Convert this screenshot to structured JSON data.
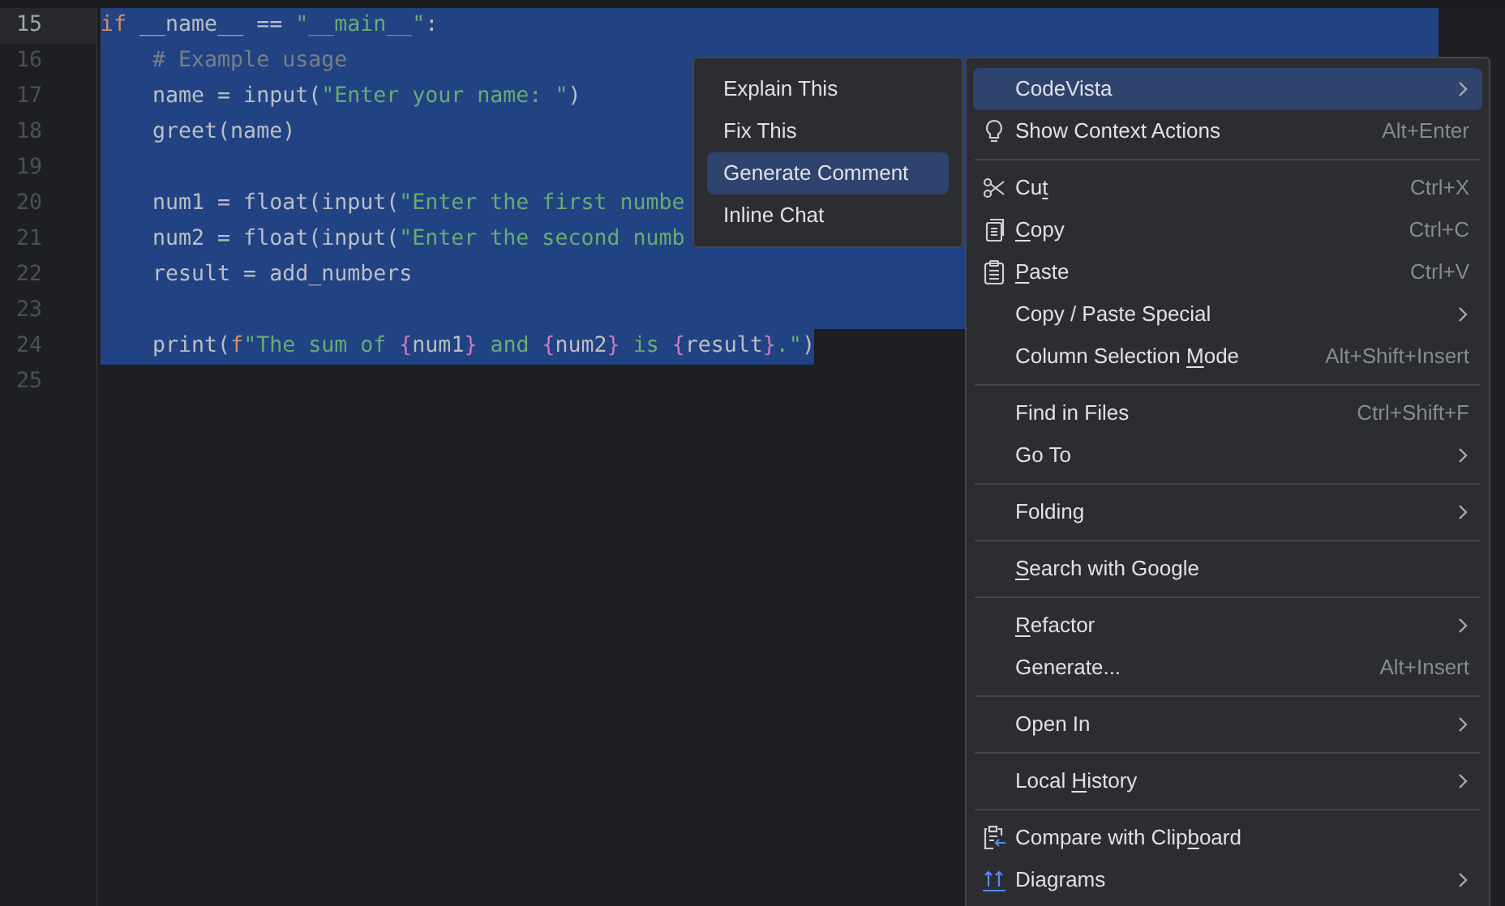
{
  "editor": {
    "lines": [
      {
        "number": "15",
        "current": true,
        "selected": true,
        "tokens": [
          {
            "kind": "keyword",
            "text": "if"
          },
          {
            "kind": "plain",
            "text": " __name__ == "
          },
          {
            "kind": "string",
            "text": "\"__main__\""
          },
          {
            "kind": "plain",
            "text": ":"
          }
        ]
      },
      {
        "number": "16",
        "current": false,
        "selected": true,
        "tokens": [
          {
            "kind": "comment",
            "text": "    # Example usage"
          }
        ]
      },
      {
        "number": "17",
        "current": false,
        "selected": true,
        "tokens": [
          {
            "kind": "plain",
            "text": "    name = input("
          },
          {
            "kind": "string",
            "text": "\"Enter your name: \""
          },
          {
            "kind": "plain",
            "text": ")"
          }
        ]
      },
      {
        "number": "18",
        "current": false,
        "selected": true,
        "tokens": [
          {
            "kind": "plain",
            "text": "    greet(name)"
          }
        ]
      },
      {
        "number": "19",
        "current": false,
        "selected": true
      },
      {
        "number": "20",
        "current": false,
        "selected": true,
        "tokens": [
          {
            "kind": "plain",
            "text": "    num1 = float(input("
          },
          {
            "kind": "string",
            "text": "\"Enter the first numbe"
          }
        ]
      },
      {
        "number": "21",
        "current": false,
        "selected": true,
        "tokens": [
          {
            "kind": "plain",
            "text": "    num2 = float(input("
          },
          {
            "kind": "string",
            "text": "\"Enter the second numb"
          }
        ]
      },
      {
        "number": "22",
        "current": false,
        "selected": true,
        "tokens": [
          {
            "kind": "plain",
            "text": "    result = add_numbers"
          }
        ]
      },
      {
        "number": "23",
        "current": false,
        "selected": true
      },
      {
        "number": "24",
        "current": false,
        "selected": true,
        "tokens": [
          {
            "kind": "plain",
            "text": "    print("
          },
          {
            "kind": "keyword",
            "text": "f"
          },
          {
            "kind": "string",
            "text": "\"The sum of "
          },
          {
            "kind": "brace",
            "text": "{"
          },
          {
            "kind": "plain",
            "text": "num1"
          },
          {
            "kind": "brace",
            "text": "}"
          },
          {
            "kind": "string",
            "text": " and "
          },
          {
            "kind": "brace",
            "text": "{"
          },
          {
            "kind": "plain",
            "text": "num2"
          },
          {
            "kind": "brace",
            "text": "}"
          },
          {
            "kind": "string",
            "text": " is "
          },
          {
            "kind": "brace",
            "text": "{"
          },
          {
            "kind": "plain",
            "text": "result"
          },
          {
            "kind": "brace",
            "text": "}"
          },
          {
            "kind": "string",
            "text": ".\""
          },
          {
            "kind": "plain",
            "text": ")"
          }
        ]
      },
      {
        "number": "25",
        "current": false,
        "selected": false
      }
    ]
  },
  "submenu": {
    "items": [
      {
        "label": "Explain This",
        "selected": false
      },
      {
        "label": "Fix This",
        "selected": false
      },
      {
        "label": "Generate Comment",
        "selected": true
      },
      {
        "label": "Inline Chat",
        "selected": false
      }
    ]
  },
  "context_menu": {
    "groups": [
      [
        {
          "label": "CodeVista",
          "selected": true,
          "submenu": true
        },
        {
          "label": "Show Context Actions",
          "shortcut": "Alt+Enter",
          "selected": false,
          "submenu": false
        }
      ],
      [
        {
          "label": "Cu",
          "mnemonic": "t",
          "shortcut": "Ctrl+X",
          "selected": false,
          "submenu": false
        },
        {
          "mnemonic": "C",
          "label_rest": "opy",
          "shortcut": "Ctrl+C",
          "selected": false,
          "submenu": false
        },
        {
          "mnemonic": "P",
          "label_rest": "aste",
          "shortcut": "Ctrl+V",
          "selected": false,
          "submenu": false
        },
        {
          "label": "Copy / Paste Special",
          "selected": false,
          "submenu": true
        },
        {
          "label": "Column Selection ",
          "mnemonic": "M",
          "label_rest": "ode",
          "shortcut": "Alt+Shift+Insert",
          "selected": false,
          "submenu": false
        }
      ],
      [
        {
          "label": "Find in Files",
          "shortcut": "Ctrl+Shift+F",
          "selected": false,
          "submenu": false
        },
        {
          "label": "Go To",
          "selected": false,
          "submenu": true
        }
      ],
      [
        {
          "label": "Folding",
          "selected": false,
          "submenu": true
        }
      ],
      [
        {
          "mnemonic": "S",
          "label_rest": "earch with Google",
          "selected": false,
          "submenu": false
        }
      ],
      [
        {
          "mnemonic": "R",
          "label_rest": "efactor",
          "selected": false,
          "submenu": true
        },
        {
          "label": "Generate...",
          "shortcut": "Alt+Insert",
          "selected": false,
          "submenu": false
        }
      ],
      [
        {
          "label": "Open In",
          "selected": false,
          "submenu": true
        }
      ],
      [
        {
          "label": "Local ",
          "mnemonic": "H",
          "label_rest": "istory",
          "selected": false,
          "submenu": true
        }
      ],
      [
        {
          "label": "Compare with Clip",
          "mnemonic": "b",
          "label_rest": "oard",
          "selected": false,
          "submenu": false
        },
        {
          "label": "Diagrams",
          "selected": false,
          "submenu": true
        }
      ]
    ]
  }
}
